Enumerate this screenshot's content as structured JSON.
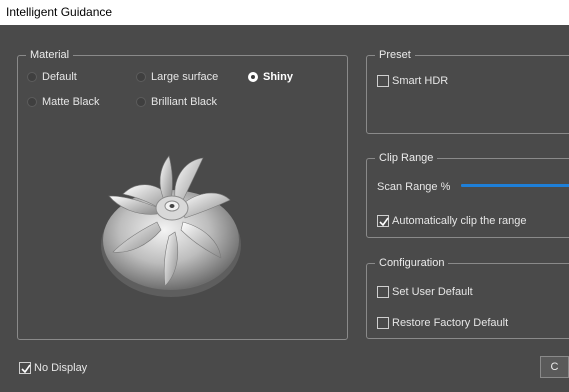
{
  "window": {
    "title": "Intelligent Guidance"
  },
  "material": {
    "label": "Material",
    "options": [
      {
        "label": "Default",
        "selected": false
      },
      {
        "label": "Large surface",
        "selected": false
      },
      {
        "label": "Shiny",
        "selected": true
      },
      {
        "label": "Matte Black",
        "selected": false
      },
      {
        "label": "Brilliant Black",
        "selected": false
      }
    ]
  },
  "preset": {
    "label": "Preset",
    "smart_hdr": {
      "label": "Smart HDR",
      "checked": false
    }
  },
  "clip_range": {
    "label": "Clip Range",
    "scan_range_label": "Scan Range %",
    "auto_clip": {
      "label": "Automatically clip the range",
      "checked": true
    }
  },
  "configuration": {
    "label": "Configuration",
    "set_user_default": {
      "label": "Set User Default",
      "checked": false
    },
    "restore_factory_default": {
      "label": "Restore Factory Default",
      "checked": false
    }
  },
  "no_display": {
    "label": "No Display",
    "checked": true
  },
  "footer": {
    "button_partial_label": "C"
  },
  "colors": {
    "accent": "#1e7fd8",
    "panel": "#4a4a4a"
  }
}
